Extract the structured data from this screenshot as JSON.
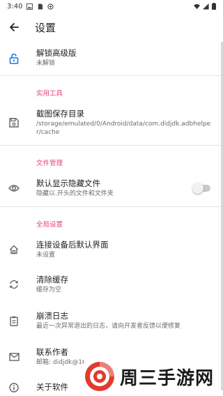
{
  "status": {
    "time": "3:40",
    "left_icon_names": [
      "image-icon",
      "sim-icon",
      "app-notif-icon"
    ],
    "right_icon_names": [
      "wifi-icon",
      "signal-icon",
      "battery-icon"
    ]
  },
  "appbar": {
    "title": "设置"
  },
  "colors": {
    "accent": "#e8437e",
    "lock_icon": "#1a73e8"
  },
  "items": {
    "unlock": {
      "title": "解锁高级版",
      "sub": "未解锁",
      "icon": "lock-open-icon"
    },
    "section_tools": "实用工具",
    "screenshot_dir": {
      "title": "截图保存目录",
      "sub": "/storage/emulated/0/Android/data/com.didjdk.adbhelper/cache",
      "icon": "save-icon"
    },
    "section_files": "文件管理",
    "hidden_files": {
      "title": "默认显示隐藏文件",
      "sub": "隐藏以.开头的文件和文件夹",
      "icon": "eye-icon",
      "toggle_on": false
    },
    "section_global": "全局设置",
    "default_screen": {
      "title": "连接设备后默认界面",
      "sub": "未设置",
      "icon": "home-icon"
    },
    "clear_cache": {
      "title": "清除缓存",
      "sub": "缓存为空",
      "icon": "refresh-icon"
    },
    "crash_log": {
      "title": "崩溃日志",
      "sub": "最近一次异常退出的日志，请向开发者反馈以便修复",
      "icon": "clipboard-icon"
    },
    "contact": {
      "title": "联系作者",
      "sub": "邮箱: didjdk@16",
      "icon": "mail-icon"
    },
    "about": {
      "title": "关于软件",
      "icon": "info-icon"
    }
  },
  "watermark": {
    "text": "周三手游网"
  }
}
